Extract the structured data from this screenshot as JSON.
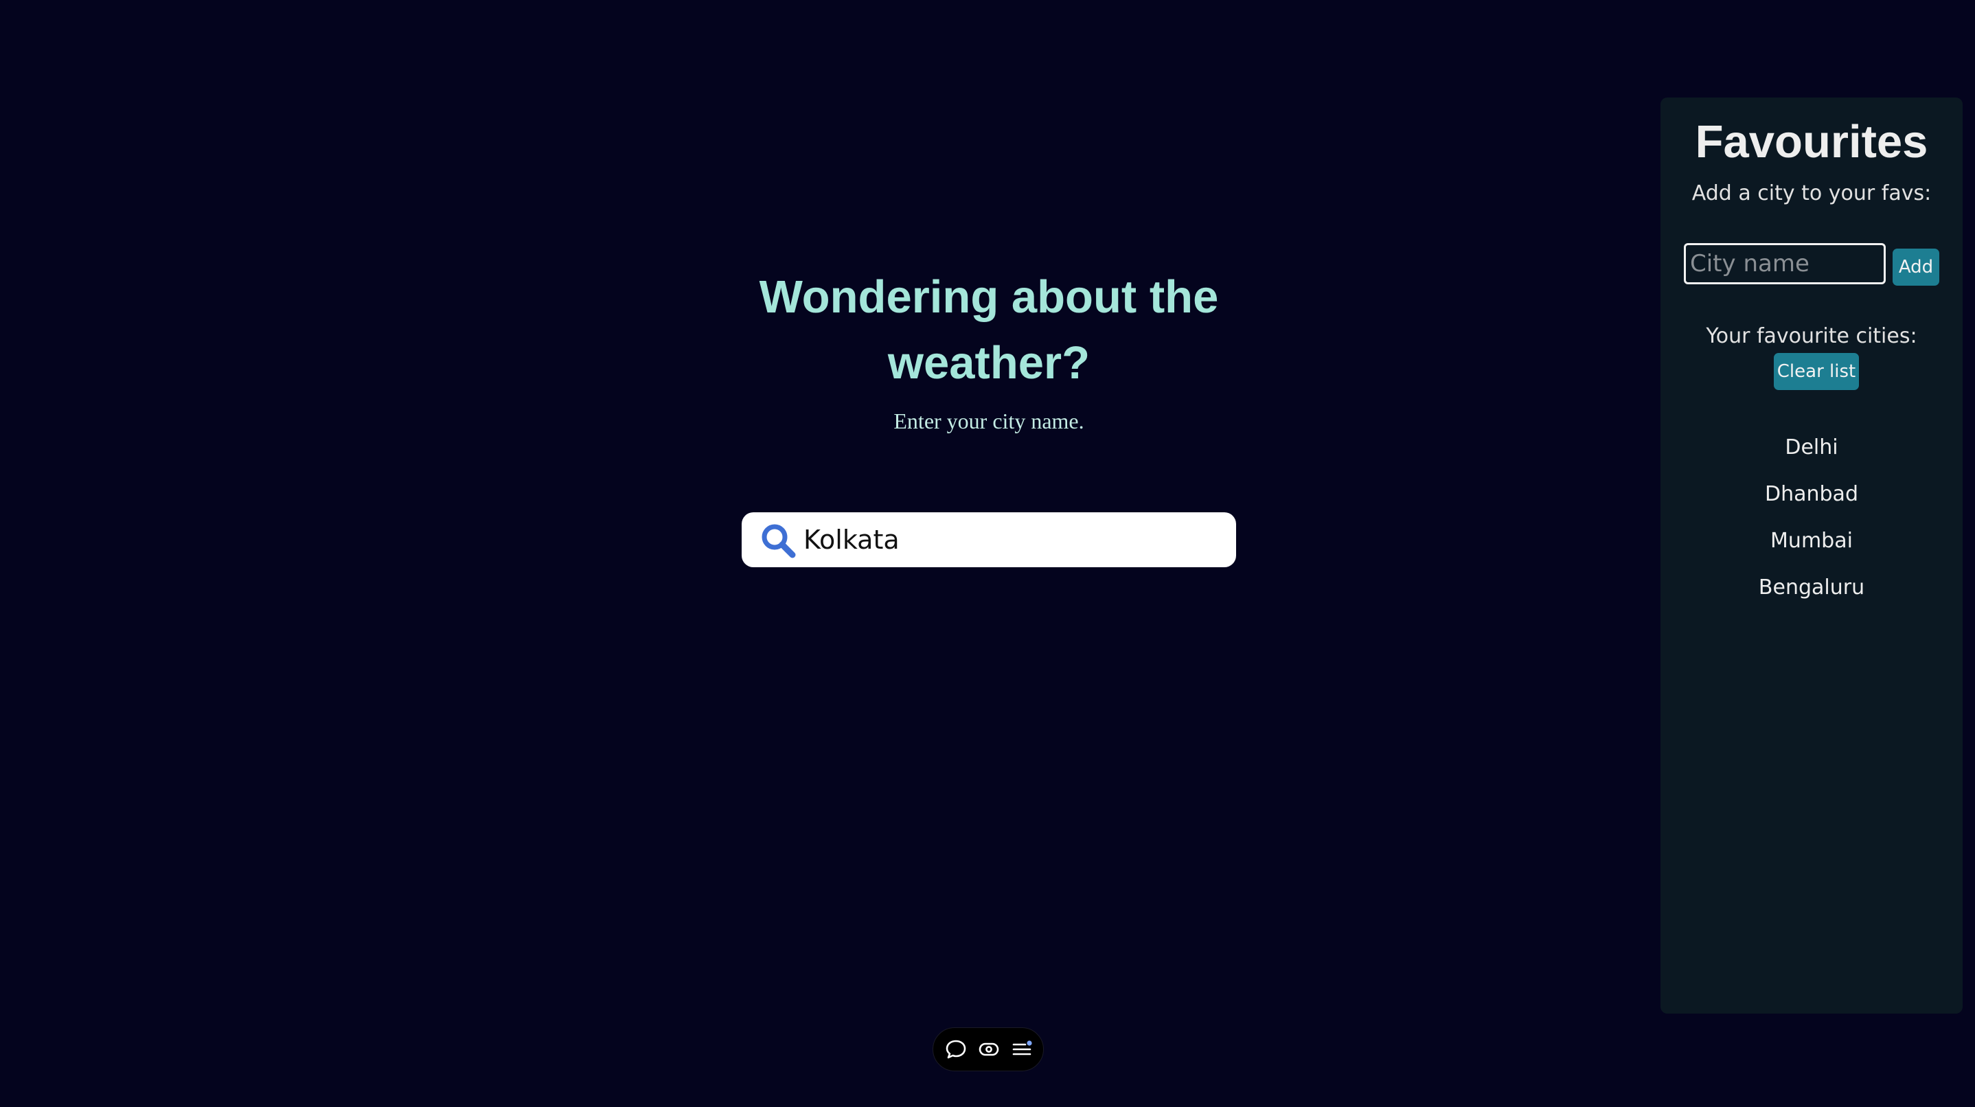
{
  "hero": {
    "title_line1": "Wondering about the",
    "title_line2": "weather?",
    "subtitle": "Enter your city name."
  },
  "search": {
    "value": "Kolkata",
    "icon": "search-icon"
  },
  "favourites": {
    "heading": "Favourites",
    "add_prompt": "Add a city to your favs:",
    "input_placeholder": "City name",
    "add_label": "Add",
    "list_label": "Your favourite cities:",
    "clear_label": "Clear list",
    "cities": [
      "Delhi",
      "Dhanbad",
      "Mumbai",
      "Bengaluru"
    ]
  },
  "toolbar": {
    "icons": [
      "comment-icon",
      "eye-icon",
      "list-settings-icon"
    ]
  },
  "colors": {
    "background": "#04041e",
    "heading": "#a4e6da",
    "sidebar": "#0b1822",
    "button": "#1d7e92",
    "search_icon": "#3e6fd4"
  }
}
